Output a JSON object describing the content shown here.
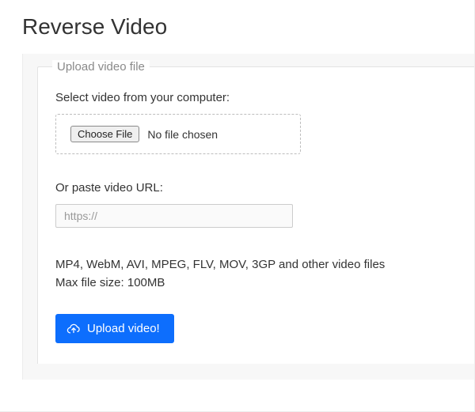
{
  "page": {
    "title": "Reverse Video"
  },
  "fieldset": {
    "legend": "Upload video file",
    "select_label": "Select video from your computer:",
    "choose_file_label": "Choose File",
    "file_status": "No file chosen",
    "url_label": "Or paste video URL:",
    "url_placeholder": "https://",
    "formats": "MP4, WebM, AVI, MPEG, FLV, MOV, 3GP and other video files",
    "max_size": "Max file size: 100MB",
    "upload_button": "Upload video!"
  }
}
